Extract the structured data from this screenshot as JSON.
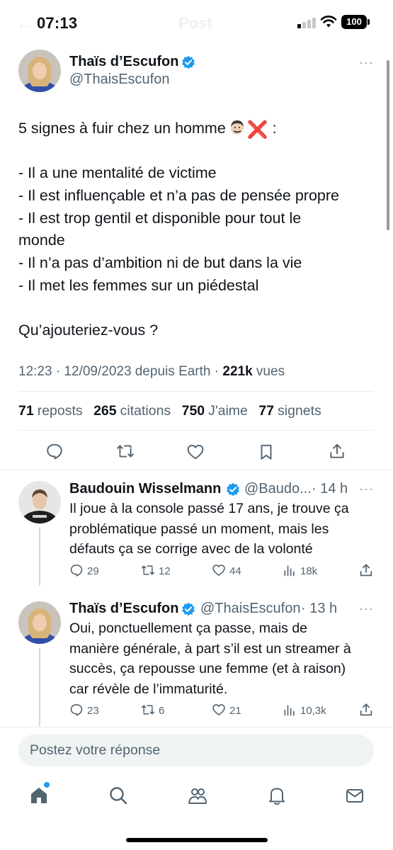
{
  "status_bar": {
    "time": "07:13",
    "battery": "100",
    "ghost_back": "←",
    "ghost_title": "Post"
  },
  "main_tweet": {
    "author_name": "Thaïs d’Escufon",
    "author_handle": "@ThaisEscufon",
    "text_lines": [
      "5 signes à fuir chez un homme",
      "",
      "- Il a une mentalité de victime",
      "- Il est influençable et n’a pas de pensée propre",
      "- Il est trop gentil et disponible pour tout le",
      "monde",
      "- Il n’a pas d’ambition ni de but dans la vie",
      "- Il met les femmes sur un piédestal",
      "",
      "Qu’ajouteriez-vous ?"
    ],
    "first_line_suffix": " :",
    "emoji_x": "❌",
    "timestamp": "12:23 · 12/09/2023 depuis Earth · ",
    "views_count": "221k",
    "views_label": " vues",
    "stats": {
      "reposts_count": "71",
      "reposts_label": "reposts",
      "citations_count": "265",
      "citations_label": "citations",
      "likes_count": "750",
      "likes_label": "J'aime",
      "bookmarks_count": "77",
      "bookmarks_label": "signets"
    }
  },
  "replies": [
    {
      "author_name": "Baudouin Wisselmann",
      "author_handle": "@Baudo...",
      "time": "· 14 h",
      "text_lines": [
        "Il joue à la console passé 17 ans, je trouve ça",
        "problématique passé un moment, mais les",
        "défauts ça se corrige avec de la volonté"
      ],
      "replies": "29",
      "reposts": "12",
      "likes": "44",
      "views": "18k"
    },
    {
      "author_name": "Thaïs d’Escufon",
      "author_handle": "@ThaisEscufon",
      "time": "· 13 h",
      "text_lines": [
        "Oui, ponctuellement ça passe, mais de",
        "manière générale, à part s’il est un streamer à",
        "succès, ça repousse une femme (et à raison)",
        "car révèle de l’immaturité."
      ],
      "replies": "23",
      "reposts": "6",
      "likes": "21",
      "views": "10,3k"
    }
  ],
  "more_icon": "···",
  "reply_box": {
    "placeholder": "Postez votre réponse"
  },
  "colors": {
    "accent": "#1d9bf0",
    "text": "#0f1419",
    "secondary": "#536471",
    "divider": "#e6ecf0",
    "input_bg": "#eff3f4"
  },
  "icons": [
    "verified-badge-icon",
    "more-icon",
    "reply-icon",
    "repost-icon",
    "like-icon",
    "bookmark-icon",
    "share-icon",
    "views-icon",
    "home-icon",
    "search-icon",
    "communities-icon",
    "notifications-icon",
    "messages-icon"
  ]
}
